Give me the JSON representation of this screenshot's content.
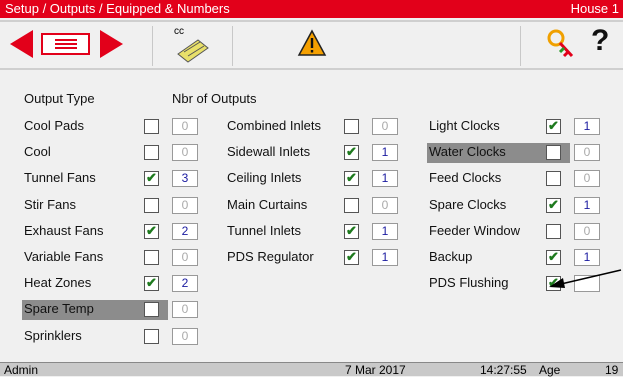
{
  "title": "Setup / Outputs / Equipped & Numbers",
  "house": "House 1",
  "toolbar": {
    "prev_icon": "left-arrow-icon",
    "list_icon": "list-icon",
    "next_icon": "right-arrow-icon",
    "cc_label": "cc",
    "warning_icon": "warning-icon",
    "key_icon": "key-icon",
    "help_label": "?"
  },
  "headers": {
    "output_type": "Output Type",
    "nbr_outputs": "Nbr of Outputs"
  },
  "col1": [
    {
      "label": "Cool Pads",
      "checked": false,
      "value": "0"
    },
    {
      "label": "Cool",
      "checked": false,
      "value": "0"
    },
    {
      "label": "Tunnel Fans",
      "checked": true,
      "value": "3"
    },
    {
      "label": "Stir Fans",
      "checked": false,
      "value": "0"
    },
    {
      "label": "Exhaust Fans",
      "checked": true,
      "value": "2"
    },
    {
      "label": "Variable Fans",
      "checked": false,
      "value": "0"
    },
    {
      "label": "Heat Zones",
      "checked": true,
      "value": "2"
    },
    {
      "label": "Spare Temp",
      "checked": false,
      "value": "0",
      "highlight": true
    },
    {
      "label": "Sprinklers",
      "checked": false,
      "value": "0"
    }
  ],
  "col2": [
    {
      "label": "Combined Inlets",
      "checked": false,
      "value": "0"
    },
    {
      "label": "Sidewall Inlets",
      "checked": true,
      "value": "1"
    },
    {
      "label": "Ceiling Inlets",
      "checked": true,
      "value": "1"
    },
    {
      "label": "Main Curtains",
      "checked": false,
      "value": "0"
    },
    {
      "label": "Tunnel Inlets",
      "checked": true,
      "value": "1"
    },
    {
      "label": "PDS Regulator",
      "checked": true,
      "value": "1"
    }
  ],
  "col3": [
    {
      "label": "Light Clocks",
      "checked": true,
      "value": "1"
    },
    {
      "label": "Water Clocks",
      "checked": false,
      "value": "0",
      "highlight": true
    },
    {
      "label": "Feed Clocks",
      "checked": false,
      "value": "0"
    },
    {
      "label": "Spare Clocks",
      "checked": true,
      "value": "1"
    },
    {
      "label": "Feeder Window",
      "checked": false,
      "value": "0"
    },
    {
      "label": "Backup",
      "checked": true,
      "value": "1"
    },
    {
      "label": "PDS Flushing",
      "checked": true,
      "value": ""
    }
  ],
  "status": {
    "user": "Admin",
    "date": "7 Mar 2017",
    "time": "14:27:55",
    "age_label": "Age",
    "age_value": "19"
  },
  "colors": {
    "accent": "#e2001a",
    "check": "#1e7a1e",
    "number": "#1a1aa0",
    "highlight": "#8c8c8c"
  }
}
